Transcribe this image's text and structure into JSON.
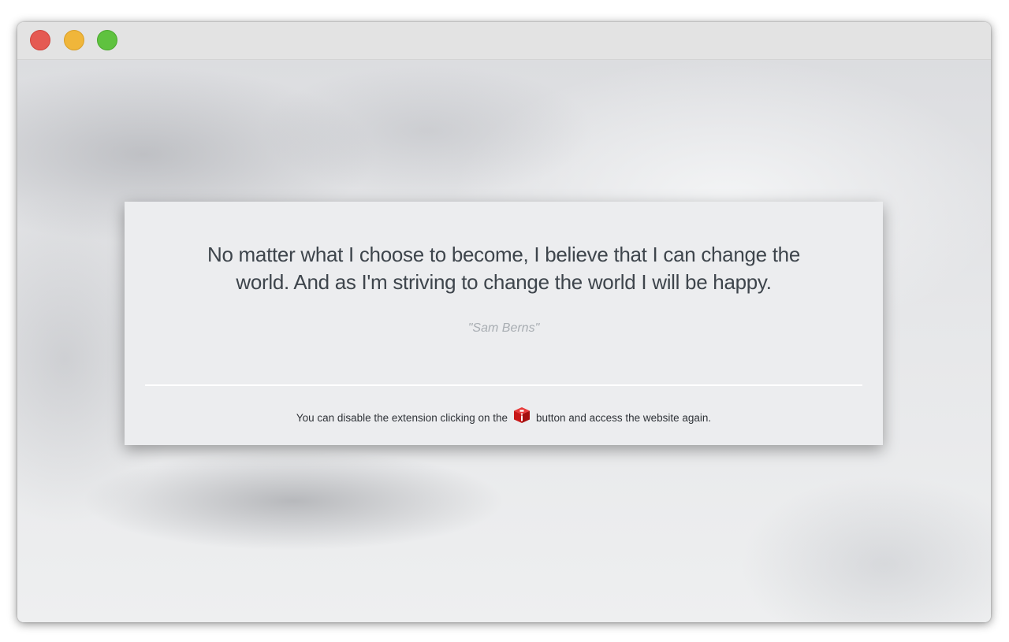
{
  "window": {
    "controls": {
      "close_color": "#e55a52",
      "minimize_color": "#f0b63a",
      "zoom_color": "#5fc23f"
    }
  },
  "card": {
    "quote_line1": "No matter what I choose to become, I believe that I can change the",
    "quote_line2": "world. And as I'm striving to change the world I will be happy.",
    "author": "\"Sam Berns\"",
    "notice_before": "You can disable the extension clicking on the",
    "notice_icon": "red-cube-icon",
    "notice_after": "button and access the website again."
  },
  "colors": {
    "card_background": "#ecedef",
    "quote_text": "#3e454c",
    "author_text": "#a8adb2",
    "icon_red": "#d11f1f"
  }
}
